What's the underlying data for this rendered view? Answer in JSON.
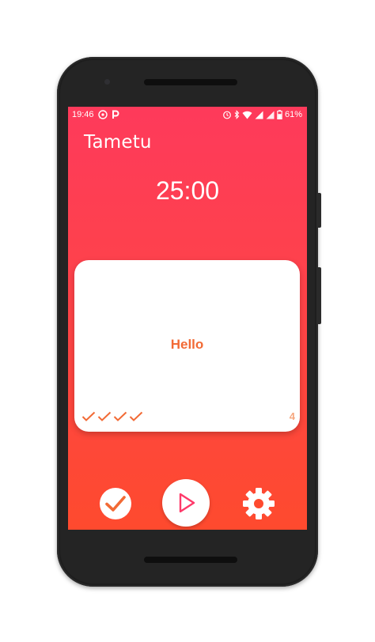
{
  "status_bar": {
    "time": "19:46",
    "battery": "61%",
    "left_icons": [
      "whatsapp-icon",
      "parking-icon"
    ],
    "right_icons": [
      "alarm-icon",
      "bluetooth-icon",
      "wifi-icon",
      "signal-icon",
      "signal-icon",
      "battery-icon"
    ]
  },
  "app": {
    "title": "Tametu",
    "timer": "25:00"
  },
  "card": {
    "text": "Hello",
    "completed_checks": 4,
    "count": "4"
  },
  "controls": {
    "done": "check-icon",
    "start": "play-icon",
    "settings": "gear-icon"
  },
  "colors": {
    "gradient_top": "#fe3a5b",
    "gradient_bottom": "#fe4a2e",
    "accent": "#f26a35",
    "count": "#f6a77f"
  }
}
